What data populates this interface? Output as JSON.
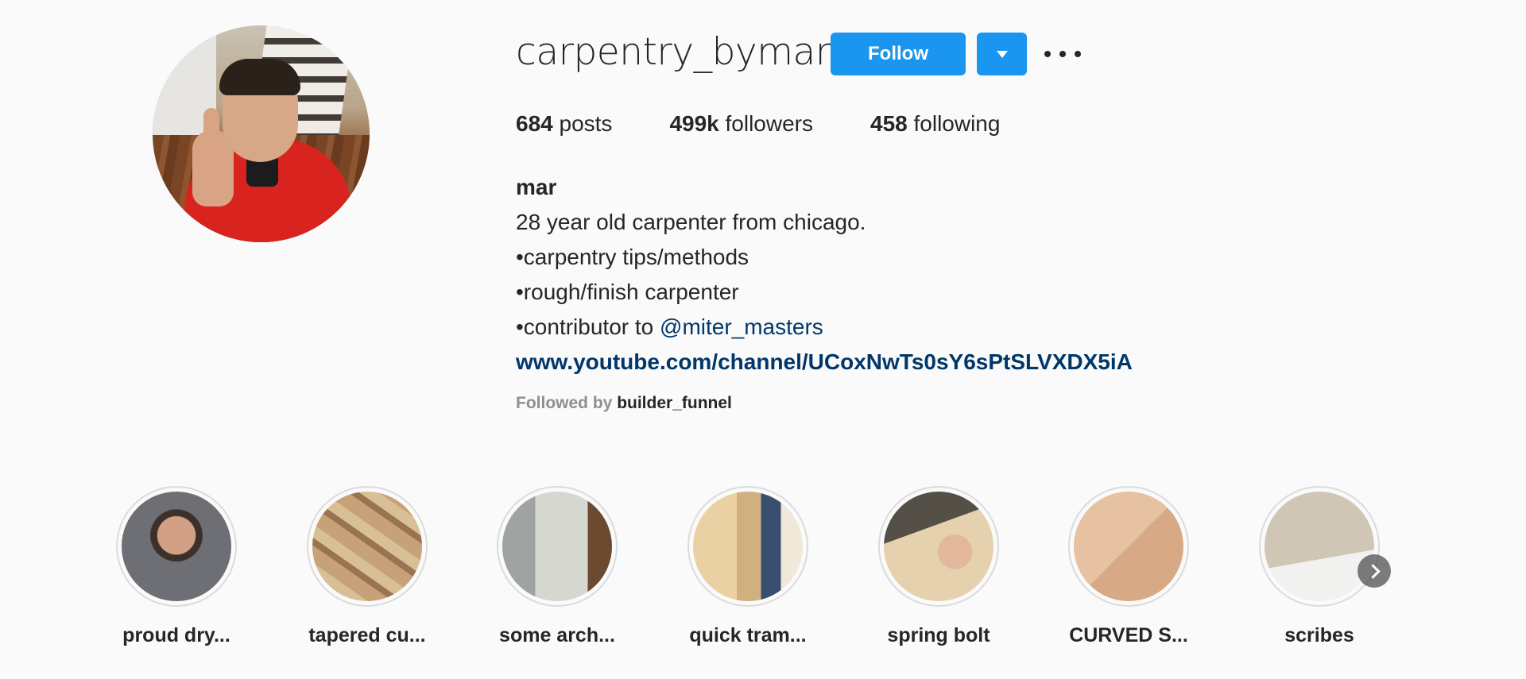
{
  "profile": {
    "username": "carpentry_bymar",
    "follow_label": "Follow",
    "dropdown_icon": "caret-down-icon",
    "more_icon": "more-options-icon",
    "stats": {
      "posts_count": "684",
      "posts_label": "posts",
      "followers_count": "499k",
      "followers_label": "followers",
      "following_count": "458",
      "following_label": "following"
    },
    "bio": {
      "name": "mar",
      "line1": "28 year old carpenter from chicago.",
      "line2": "•carpentry tips/methods",
      "line3": "•rough/finish carpenter",
      "line4_prefix": "•contributor to ",
      "line4_mention": "@miter_masters",
      "link": "www.youtube.com/channel/UCoxNwTs0sY6sPtSLVXDX5iA"
    },
    "followed_by_label": "Followed by",
    "followed_by_user": "builder_funnel"
  },
  "highlights": [
    {
      "label": "proud dry..."
    },
    {
      "label": "tapered cu..."
    },
    {
      "label": "some arch..."
    },
    {
      "label": "quick tram..."
    },
    {
      "label": "spring bolt"
    },
    {
      "label": "CURVED S..."
    },
    {
      "label": "scribes"
    }
  ],
  "colors": {
    "accent": "#1a95f0",
    "link": "#00376b",
    "background": "#fafafa",
    "text": "#262626",
    "muted": "#8e8e8e"
  }
}
